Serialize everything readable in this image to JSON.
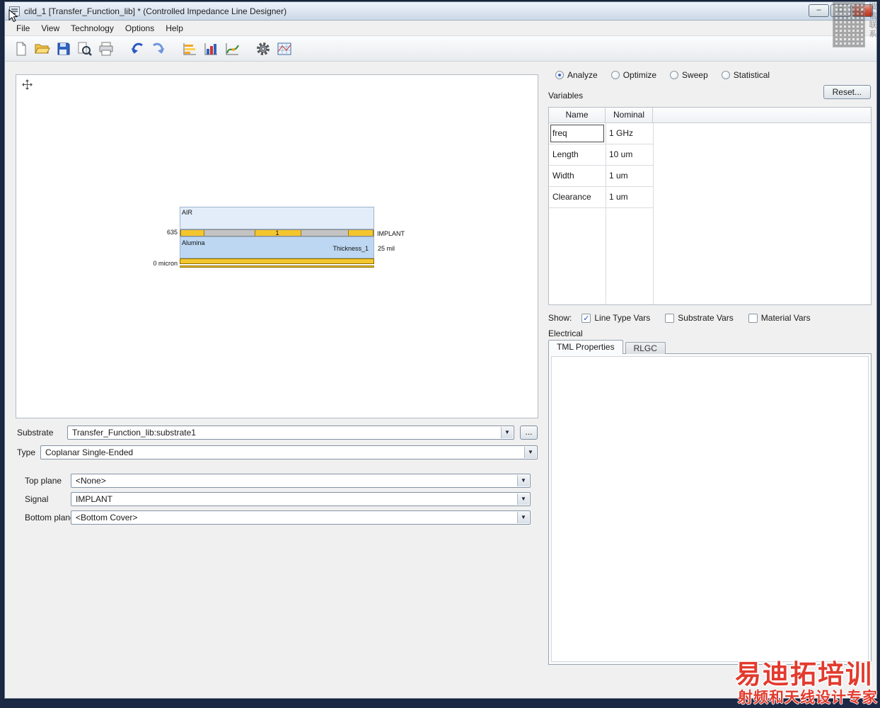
{
  "window": {
    "title": "cild_1 [Transfer_Function_lib] * (Controlled Impedance Line Designer)",
    "minimize": "–",
    "maximize": "□",
    "close": "✕"
  },
  "menu": {
    "items": [
      "File",
      "View",
      "Technology",
      "Options",
      "Help"
    ]
  },
  "toolbar": {
    "icons": [
      "new-file",
      "open-folder",
      "save",
      "find-zoom",
      "print",
      "undo",
      "redo",
      "hbar-chart",
      "stat-chart",
      "curve-chart",
      "gear",
      "grid-plot"
    ]
  },
  "diagram": {
    "air": "AIR",
    "left_height": "635",
    "trace_number": "1",
    "signal": "IMPLANT",
    "material": "Alumina",
    "thickness_name": "Thickness_1",
    "thickness_value": "25 mil",
    "baseline": "0 micron"
  },
  "form": {
    "substrate_label": "Substrate",
    "substrate_value": "Transfer_Function_lib:substrate1",
    "browse": "...",
    "type_label": "Type",
    "type_value": "Coplanar Single-Ended",
    "top_plane_label": "Top plane",
    "top_plane_value": "<None>",
    "signal_label": "Signal",
    "signal_value": "IMPLANT",
    "bottom_plane_label": "Bottom plane",
    "bottom_plane_value": "<Bottom Cover>"
  },
  "analysis": {
    "modes": [
      {
        "label": "Analyze",
        "selected": true
      },
      {
        "label": "Optimize",
        "selected": false
      },
      {
        "label": "Sweep",
        "selected": false
      },
      {
        "label": "Statistical",
        "selected": false
      }
    ],
    "variables_label": "Variables",
    "reset_button": "Reset...",
    "table": {
      "headers": [
        "Name",
        "Nominal"
      ],
      "rows": [
        {
          "name": "freq",
          "nominal": "1 GHz"
        },
        {
          "name": "Length",
          "nominal": "10 um"
        },
        {
          "name": "Width",
          "nominal": "1 um"
        },
        {
          "name": "Clearance",
          "nominal": "1 um"
        }
      ]
    },
    "show_label": "Show:",
    "show_options": [
      {
        "label": "Line Type Vars",
        "checked": true
      },
      {
        "label": "Substrate Vars",
        "checked": false
      },
      {
        "label": "Material Vars",
        "checked": false
      }
    ],
    "electrical_label": "Electrical",
    "tabs": [
      {
        "label": "TML Properties",
        "active": true
      },
      {
        "label": "RLGC",
        "active": false
      }
    ]
  },
  "watermarks": {
    "qr_caption": "微信联系",
    "brand": "易迪拓培训",
    "tagline": "射频和天线设计专家"
  }
}
